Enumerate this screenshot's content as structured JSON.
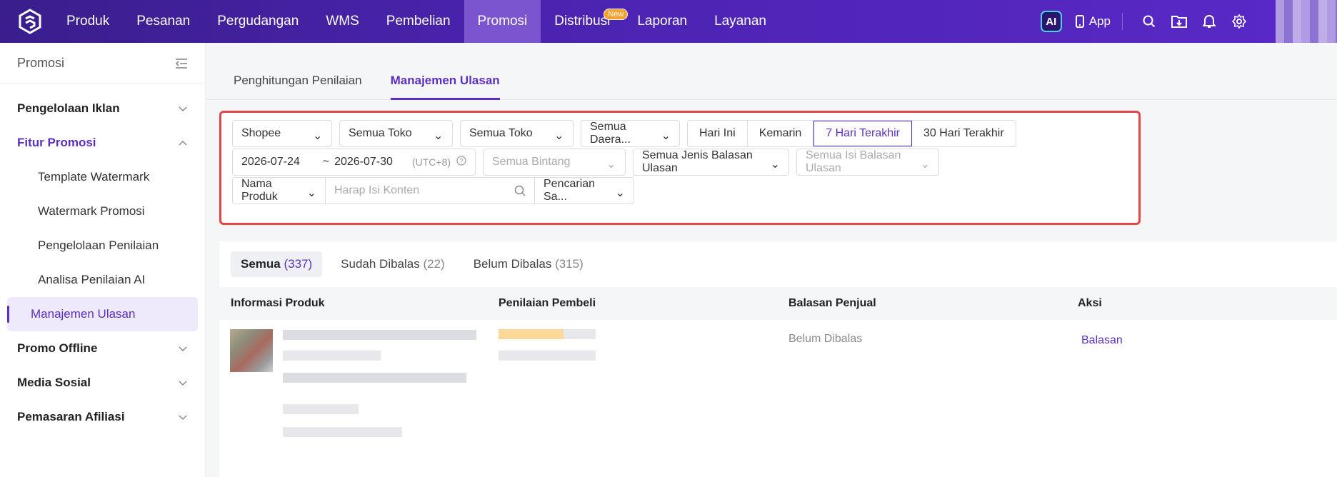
{
  "topnav": {
    "items": [
      {
        "label": "Produk",
        "active": false
      },
      {
        "label": "Pesanan",
        "active": false
      },
      {
        "label": "Pergudangan",
        "active": false
      },
      {
        "label": "WMS",
        "active": false
      },
      {
        "label": "Pembelian",
        "active": false
      },
      {
        "label": "Promosi",
        "active": true
      },
      {
        "label": "Distribusi",
        "active": false,
        "badge": "New"
      },
      {
        "label": "Laporan",
        "active": false
      },
      {
        "label": "Layanan",
        "active": false
      }
    ],
    "ai_label": "AI",
    "app_label": "App",
    "icons": [
      "search-icon",
      "folder-download-icon",
      "bell-icon",
      "gear-icon"
    ]
  },
  "sidebar": {
    "title": "Promosi",
    "groups": [
      {
        "label": "Pengelolaan Iklan",
        "open": false
      },
      {
        "label": "Fitur Promosi",
        "open": true,
        "items": [
          {
            "label": "Template Watermark",
            "active": false
          },
          {
            "label": "Watermark Promosi",
            "active": false
          },
          {
            "label": "Pengelolaan Penilaian",
            "active": false
          },
          {
            "label": "Analisa Penilaian AI",
            "active": false
          },
          {
            "label": "Manajemen Ulasan",
            "active": true
          }
        ]
      },
      {
        "label": "Promo Offline",
        "open": false
      },
      {
        "label": "Media Sosial",
        "open": false
      },
      {
        "label": "Pemasaran Afiliasi",
        "open": false
      }
    ]
  },
  "tabs": [
    {
      "label": "Penghitungan Penilaian",
      "active": false
    },
    {
      "label": "Manajemen Ulasan",
      "active": true
    }
  ],
  "filters": {
    "platform": "Shopee",
    "store1": "Semua Toko",
    "store2": "Semua Toko",
    "region": "Semua Daera...",
    "date_presets": [
      {
        "label": "Hari Ini",
        "active": false
      },
      {
        "label": "Kemarin",
        "active": false
      },
      {
        "label": "7 Hari Terakhir",
        "active": true
      },
      {
        "label": "30 Hari Terakhir",
        "active": false
      }
    ],
    "date_start": "2026-07-24",
    "date_sep": "~",
    "date_end": "2026-07-30",
    "timezone": "(UTC+8)",
    "star_placeholder": "Semua Bintang",
    "reply_type": "Semua Jenis Balasan Ulasan",
    "reply_content_placeholder": "Semua Isi Balasan Ulasan",
    "search_field": "Nama Produk",
    "search_placeholder": "Harap Isi Konten",
    "search_mode": "Pencarian Sa..."
  },
  "status_tabs": [
    {
      "label": "Semua",
      "count": "(337)",
      "active": true
    },
    {
      "label": "Sudah Dibalas",
      "count": "(22)",
      "active": false
    },
    {
      "label": "Belum Dibalas",
      "count": "(315)",
      "active": false
    }
  ],
  "table": {
    "columns": [
      "Informasi Produk",
      "Penilaian Pembeli",
      "Balasan Penjual",
      "Aksi"
    ],
    "rows": [
      {
        "seller_reply": "Belum Dibalas",
        "action": "Balasan"
      }
    ]
  },
  "colors": {
    "brand": "#5a2fc2",
    "highlight_border": "#e54545",
    "new_badge": "#f6a12b"
  }
}
